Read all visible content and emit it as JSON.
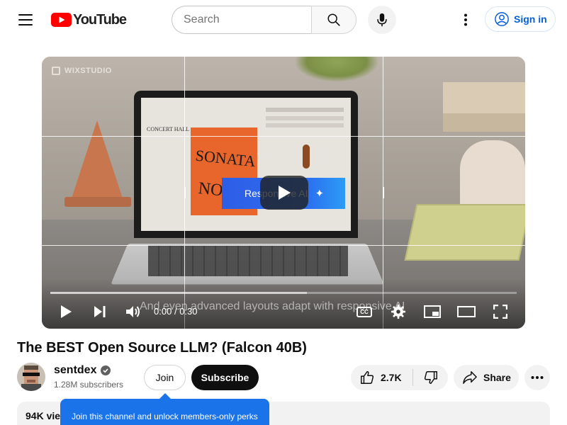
{
  "masthead": {
    "logo_text": "YouTube",
    "search": {
      "placeholder": "Search",
      "value": ""
    },
    "signin_label": "Sign in",
    "icons": {
      "menu": "hamburger-menu-icon",
      "search": "search-icon",
      "mic": "microphone-icon",
      "more": "more-vert-icon",
      "account": "account-circle-icon"
    },
    "brand_color": "#ff0000",
    "link_color": "#065fd4"
  },
  "player": {
    "watermark": "WIXSTUDIO",
    "overlay_banner": "Responsive AI",
    "caption": "And even advanced layouts adapt with responsive AI",
    "current_time": "0:00",
    "duration": "0:30",
    "time_separator": "/",
    "loaded_fraction": 0.55,
    "controls": [
      "play",
      "next",
      "volume",
      "subtitles",
      "settings",
      "miniplayer",
      "theater",
      "fullscreen"
    ],
    "screen_title_text": "CONCERT HALL",
    "poster_text": "SONATA NO.41"
  },
  "video": {
    "title": "The BEST Open Source LLM? (Falcon 40B)",
    "channel": "sentdex",
    "verified": true,
    "subscribers": "1.28M subscribers",
    "join_label": "Join",
    "subscribe_label": "Subscribe",
    "likes": "2.7K",
    "share_label": "Share",
    "views_prefix": "94K view"
  },
  "tooltip": {
    "text": "Join this channel and unlock members-only perks",
    "color": "#1a73e8"
  }
}
